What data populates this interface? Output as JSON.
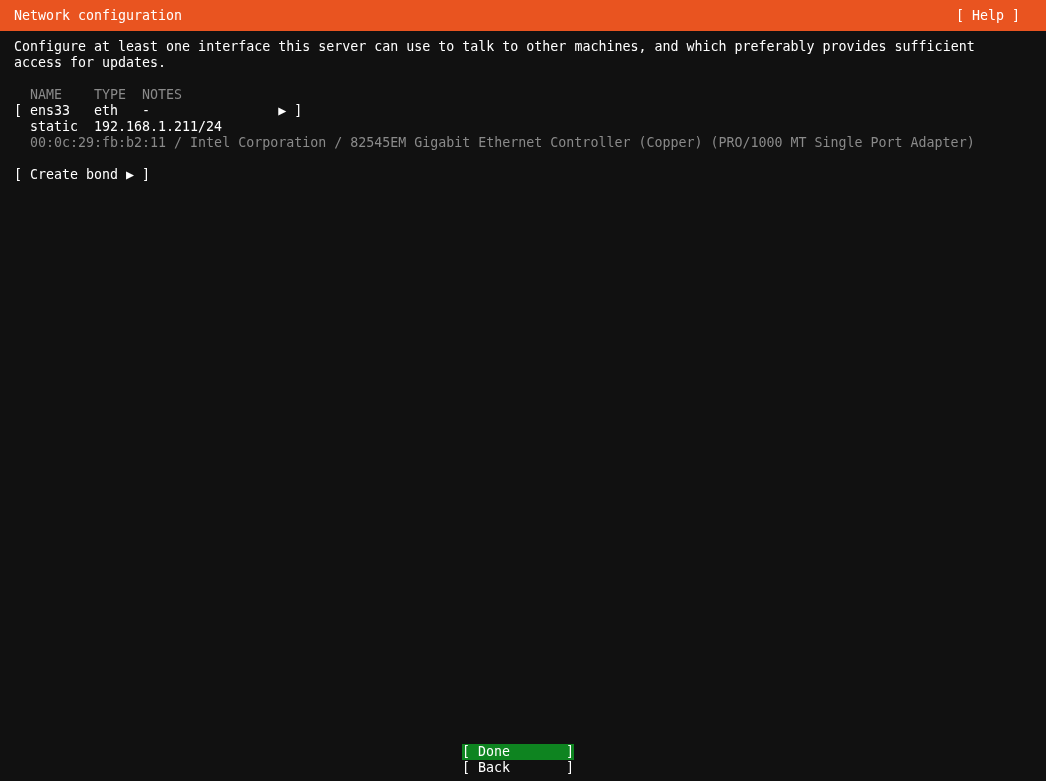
{
  "header": {
    "title": "Network configuration",
    "help": "[ Help ]"
  },
  "description": "Configure at least one interface this server can use to talk to other machines, and which preferably provides sufficient access for updates.",
  "table": {
    "columns": [
      "NAME",
      "TYPE",
      "NOTES"
    ],
    "interfaces": [
      {
        "open": "[",
        "name": "ens33",
        "type": "eth",
        "notes": "-",
        "arrow": "▶",
        "close": "]",
        "address_kind": "static",
        "address": "192.168.1.211/24",
        "hardware": "00:0c:29:fb:b2:11 / Intel Corporation / 82545EM Gigabit Ethernet Controller (Copper) (PRO/1000 MT Single Port Adapter)"
      }
    ]
  },
  "create_bond": "[ Create bond ▶ ]",
  "buttons": [
    {
      "open": "[",
      "label": "Done",
      "close": "]",
      "selected": true
    },
    {
      "open": "[",
      "label": "Back",
      "close": "]",
      "selected": false
    }
  ]
}
